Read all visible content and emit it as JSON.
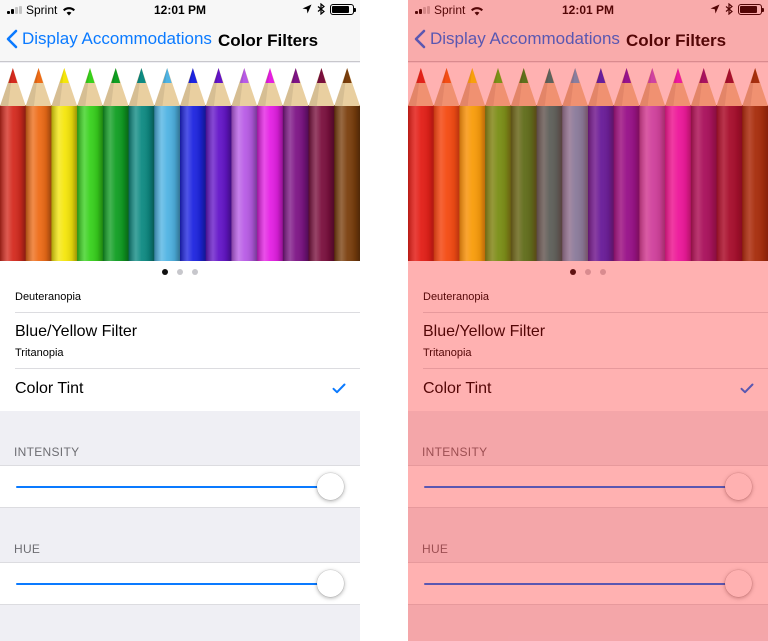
{
  "status_bar": {
    "carrier": "Sprint",
    "time": "12:01 PM",
    "battery_level": 0.85
  },
  "nav": {
    "back_label": "Display Accommodations",
    "title": "Color Filters"
  },
  "pencils": {
    "colors": [
      "#d42a1e",
      "#ee6b16",
      "#f5e60a",
      "#37d11c",
      "#0f9e22",
      "#0d8a82",
      "#4fb3e3",
      "#1d24e0",
      "#6314c8",
      "#b85be6",
      "#e41ee3",
      "#7d1485",
      "#7a0f3d",
      "#7a3e0c"
    ]
  },
  "pager": {
    "count": 3,
    "active_index": 0
  },
  "list": {
    "partial_row_subtitle": "Deuteranopia",
    "blue_yellow": {
      "title": "Blue/Yellow Filter",
      "subtitle": "Tritanopia"
    },
    "color_tint": {
      "title": "Color Tint",
      "selected": true
    }
  },
  "intensity": {
    "header": "INTENSITY",
    "value": 1.0
  },
  "hue": {
    "header": "HUE",
    "value": 1.0
  },
  "colors": {
    "accent": "#0a7aff",
    "group_background": "#efeff4",
    "tint_overlay": "#ff1212"
  }
}
